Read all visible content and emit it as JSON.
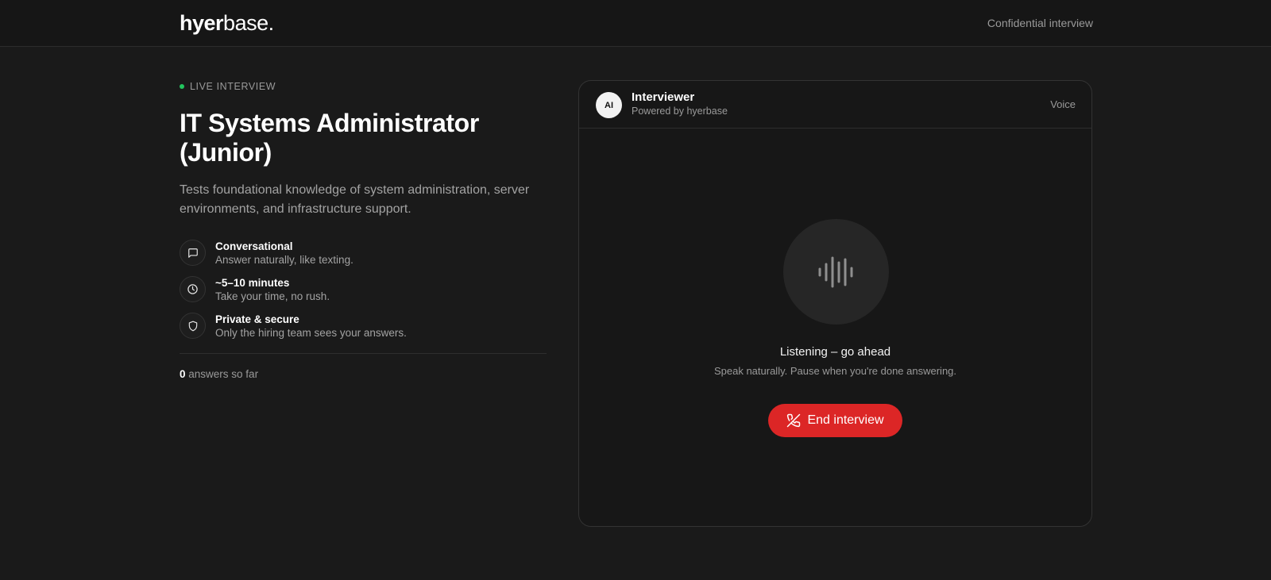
{
  "header": {
    "logo_bold": "hyer",
    "logo_light": "base.",
    "confidential": "Confidential interview"
  },
  "intro": {
    "badge": "LIVE INTERVIEW",
    "title": "IT Systems Administrator (Junior)",
    "description": "Tests foundational knowledge of system administration, server environments, and infrastructure support.",
    "features": [
      {
        "icon": "chat-bubble-icon",
        "title": "Conversational",
        "subtitle": "Answer naturally, like texting."
      },
      {
        "icon": "clock-icon",
        "title": "~5–10 minutes",
        "subtitle": "Take your time, no rush."
      },
      {
        "icon": "shield-icon",
        "title": "Private & secure",
        "subtitle": "Only the hiring team sees your answers."
      }
    ],
    "answers_count": "0",
    "answers_label": "answers so far"
  },
  "interviewer": {
    "avatar": "AI",
    "name": "Interviewer",
    "powered_by": "Powered by hyerbase",
    "mode": "Voice",
    "status": "Listening – go ahead",
    "hint": "Speak naturally. Pause when you're done answering.",
    "end_button": "End interview"
  },
  "colors": {
    "accent_red": "#dc2626",
    "live_green": "#22c55e",
    "background": "#1a1a1a"
  }
}
